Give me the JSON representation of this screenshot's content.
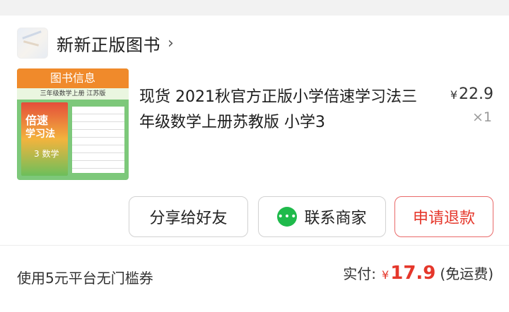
{
  "shop": {
    "name": "新新正版图书",
    "chevron": "›"
  },
  "product": {
    "title": "现货 2021秋官方正版小学倍速学习法三年级数学上册苏教版 小学3",
    "currency": "¥",
    "price": "22.9",
    "quantity": "×1",
    "thumbnail": {
      "header": "图书信息",
      "subheader": "三年级数学上册  江苏版",
      "cover_line1": "倍速",
      "cover_line2": "学习法",
      "cover_line3": "3 数学"
    }
  },
  "actions": {
    "share_label": "分享给好友",
    "contact_label": "联系商家",
    "refund_label": "申请退款"
  },
  "footer": {
    "coupon_text": "使用5元平台无门槛券",
    "paid_label": "实付:",
    "paid_currency": "¥",
    "paid_amount": "17.9",
    "shipping_note": "(免运费)"
  },
  "colors": {
    "accent_red": "#e5372b",
    "chat_green": "#1fba4b"
  }
}
